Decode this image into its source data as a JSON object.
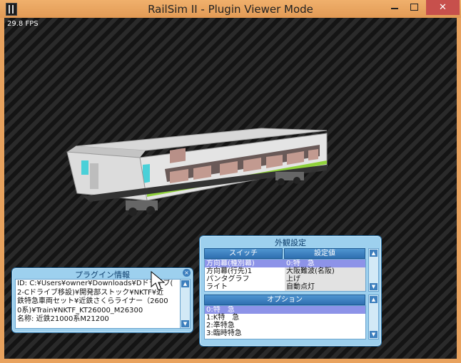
{
  "window": {
    "title": "RailSim II - Plugin Viewer Mode",
    "minimize_glyph": "",
    "close_glyph": "✕"
  },
  "viewport": {
    "fps": "29.8 FPS"
  },
  "plugin_info": {
    "title": "プラグイン情報",
    "close_glyph": "×",
    "lines": [
      "ID: C:¥Users¥owner¥Downloads¥Dドライブ(",
      "2-Cドライブ移設)¥開発部ストック¥NKTF¥近",
      "鉄特急車両セット¥近鉄さくらライナー（2600",
      "0系)¥Train¥NKTF_KT26000_M26300",
      "名称: 近鉄21000系M21200"
    ]
  },
  "appearance": {
    "title": "外観設定",
    "switch_header": "スイッチ",
    "value_header": "設定値",
    "switches": [
      {
        "name": "方向幕(種別幕)",
        "value": "0:特　急",
        "selected": true
      },
      {
        "name": "方向幕(行先)1",
        "value": "大阪難波(名阪)",
        "selected": false
      },
      {
        "name": "パンタグラフ",
        "value": "上げ",
        "selected": false
      },
      {
        "name": "ライト",
        "value": "自動点灯",
        "selected": false
      }
    ],
    "option_header": "オプション",
    "options": [
      {
        "label": "0:特　急",
        "selected": true
      },
      {
        "label": "1:K特　急",
        "selected": false
      },
      {
        "label": "2:準特急",
        "selected": false
      },
      {
        "label": "3:臨時特急",
        "selected": false
      }
    ]
  },
  "colors": {
    "titlebar": "#e8a25e",
    "close_button": "#c7504c",
    "panel": "#9dd0ee",
    "selection": "#8d93e8",
    "train_stripe": "#8fd13a"
  }
}
